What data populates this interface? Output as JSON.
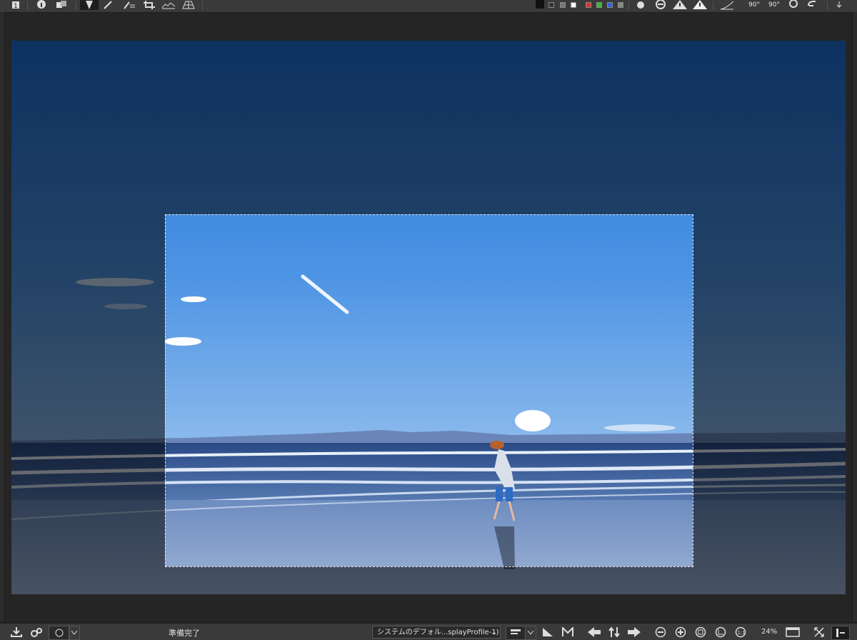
{
  "top_toolbar": {
    "icons": [
      "cursor-icon",
      "info-icon",
      "compare-icon",
      "pen-tool-icon",
      "brush-icon",
      "picker-list-icon",
      "crop-icon",
      "histogram-icon",
      "grid-icon"
    ],
    "right_icons": [
      "rotate-left-90-icon",
      "rotate-right-90-icon"
    ],
    "rotate_left_label": "90°",
    "rotate_right_label": "90°",
    "swatch_colors": [
      "#000000",
      "#555555",
      "#aaaaaa",
      "#ffffff",
      "#e03030",
      "#30c030",
      "#3060e0",
      "#888888"
    ]
  },
  "image": {
    "description_colors": {
      "sky": "#2f7fd9",
      "sea": "#2b4d8a",
      "sand": "#8ea6c8"
    }
  },
  "statusbar": {
    "status_text": "準備完了",
    "profile_label": "システムのデフォル...splayProfile-1)",
    "zoom_label": "24%"
  }
}
